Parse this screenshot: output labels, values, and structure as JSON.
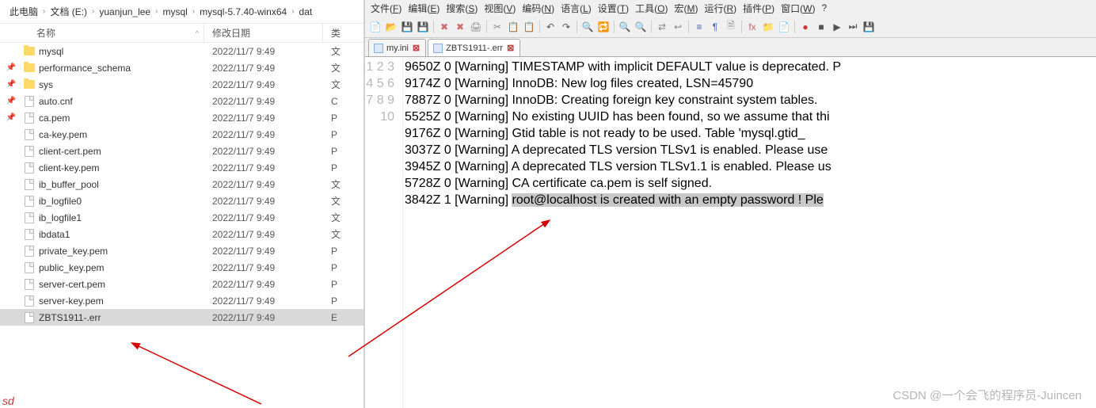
{
  "breadcrumb": [
    "此电脑",
    "文档 (E:)",
    "yuanjun_lee",
    "mysql",
    "mysql-5.7.40-winx64",
    "dat"
  ],
  "explorer": {
    "header_name": "名称",
    "header_date": "修改日期",
    "header_type": "类",
    "files": [
      {
        "name": "mysql",
        "date": "2022/11/7 9:49",
        "type": "文",
        "kind": "folder",
        "pin": false,
        "sel": false
      },
      {
        "name": "performance_schema",
        "date": "2022/11/7 9:49",
        "type": "文",
        "kind": "folder",
        "pin": true,
        "sel": false
      },
      {
        "name": "sys",
        "date": "2022/11/7 9:49",
        "type": "文",
        "kind": "folder",
        "pin": true,
        "sel": false
      },
      {
        "name": "auto.cnf",
        "date": "2022/11/7 9:49",
        "type": "C",
        "kind": "file",
        "pin": true,
        "sel": false
      },
      {
        "name": "ca.pem",
        "date": "2022/11/7 9:49",
        "type": "P",
        "kind": "file",
        "pin": true,
        "sel": false
      },
      {
        "name": "ca-key.pem",
        "date": "2022/11/7 9:49",
        "type": "P",
        "kind": "file",
        "pin": false,
        "sel": false
      },
      {
        "name": "client-cert.pem",
        "date": "2022/11/7 9:49",
        "type": "P",
        "kind": "file",
        "pin": false,
        "sel": false
      },
      {
        "name": "client-key.pem",
        "date": "2022/11/7 9:49",
        "type": "P",
        "kind": "file",
        "pin": false,
        "sel": false
      },
      {
        "name": "ib_buffer_pool",
        "date": "2022/11/7 9:49",
        "type": "文",
        "kind": "file",
        "pin": false,
        "sel": false
      },
      {
        "name": "ib_logfile0",
        "date": "2022/11/7 9:49",
        "type": "文",
        "kind": "file",
        "pin": false,
        "sel": false
      },
      {
        "name": "ib_logfile1",
        "date": "2022/11/7 9:49",
        "type": "文",
        "kind": "file",
        "pin": false,
        "sel": false
      },
      {
        "name": "ibdata1",
        "date": "2022/11/7 9:49",
        "type": "文",
        "kind": "file",
        "pin": false,
        "sel": false
      },
      {
        "name": "private_key.pem",
        "date": "2022/11/7 9:49",
        "type": "P",
        "kind": "file",
        "pin": false,
        "sel": false
      },
      {
        "name": "public_key.pem",
        "date": "2022/11/7 9:49",
        "type": "P",
        "kind": "file",
        "pin": false,
        "sel": false
      },
      {
        "name": "server-cert.pem",
        "date": "2022/11/7 9:49",
        "type": "P",
        "kind": "file",
        "pin": false,
        "sel": false
      },
      {
        "name": "server-key.pem",
        "date": "2022/11/7 9:49",
        "type": "P",
        "kind": "file",
        "pin": false,
        "sel": false
      },
      {
        "name": "ZBTS1911-.err",
        "date": "2022/11/7 9:49",
        "type": "E",
        "kind": "file",
        "pin": false,
        "sel": true
      }
    ]
  },
  "menus": [
    "文件(F)",
    "编辑(E)",
    "搜索(S)",
    "视图(V)",
    "编码(N)",
    "语言(L)",
    "设置(T)",
    "工具(O)",
    "宏(M)",
    "运行(R)",
    "插件(P)",
    "窗口(W)",
    "?"
  ],
  "tabs": [
    {
      "label": "my.ini",
      "active": false
    },
    {
      "label": "ZBTS1911-.err",
      "active": true
    }
  ],
  "code": {
    "lines": [
      "9650Z 0 [Warning] TIMESTAMP with implicit DEFAULT value is deprecated. P",
      "9174Z 0 [Warning] InnoDB: New log files created, LSN=45790",
      "7887Z 0 [Warning] InnoDB: Creating foreign key constraint system tables.",
      "5525Z 0 [Warning] No existing UUID has been found, so we assume that thi",
      "9176Z 0 [Warning] Gtid table is not ready to be used. Table 'mysql.gtid_",
      "3037Z 0 [Warning] A deprecated TLS version TLSv1 is enabled. Please use ",
      "3945Z 0 [Warning] A deprecated TLS version TLSv1.1 is enabled. Please us",
      "5728Z 0 [Warning] CA certificate ca.pem is self signed.",
      "3842Z 1 [Warning] "
    ],
    "highlight_tail": "root@localhost is created with an empty password ! Ple",
    "line_count": 10
  },
  "watermark": "CSDN @一个会飞的程序员-Juincen",
  "sd": "sd"
}
